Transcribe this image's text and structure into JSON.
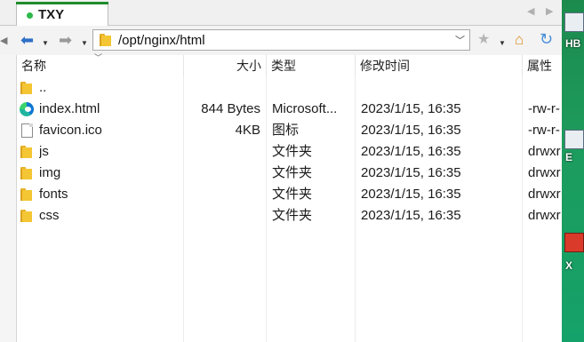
{
  "tab": {
    "title": "TXY"
  },
  "address": {
    "path": "/opt/nginx/html"
  },
  "columns": {
    "name": "名称",
    "size": "大小",
    "type": "类型",
    "modified": "修改时间",
    "attrs": "属性"
  },
  "files": [
    {
      "name": "..",
      "icon": "folder-icon",
      "size": "",
      "type": "",
      "modified": "",
      "attrs": ""
    },
    {
      "name": "index.html",
      "icon": "edge-browser-icon",
      "size": "844 Bytes",
      "type": "Microsoft...",
      "modified": "2023/1/15, 16:35",
      "attrs": "-rw-r-"
    },
    {
      "name": "favicon.ico",
      "icon": "file-icon",
      "size": "4KB",
      "type": "图标",
      "modified": "2023/1/15, 16:35",
      "attrs": "-rw-r-"
    },
    {
      "name": "js",
      "icon": "folder-icon",
      "size": "",
      "type": "文件夹",
      "modified": "2023/1/15, 16:35",
      "attrs": "drwxr"
    },
    {
      "name": "img",
      "icon": "folder-icon",
      "size": "",
      "type": "文件夹",
      "modified": "2023/1/15, 16:35",
      "attrs": "drwxr"
    },
    {
      "name": "fonts",
      "icon": "folder-icon",
      "size": "",
      "type": "文件夹",
      "modified": "2023/1/15, 16:35",
      "attrs": "drwxr"
    },
    {
      "name": "css",
      "icon": "folder-icon",
      "size": "",
      "type": "文件夹",
      "modified": "2023/1/15, 16:35",
      "attrs": "drwxr"
    }
  ],
  "desktop": {
    "labels": [
      "HB",
      "E",
      "X"
    ]
  },
  "colors": {
    "tab_accent": "#1e8c2a",
    "nav_arrow": "#2f6fc7",
    "desktop_bg": "#1d9b5c"
  }
}
